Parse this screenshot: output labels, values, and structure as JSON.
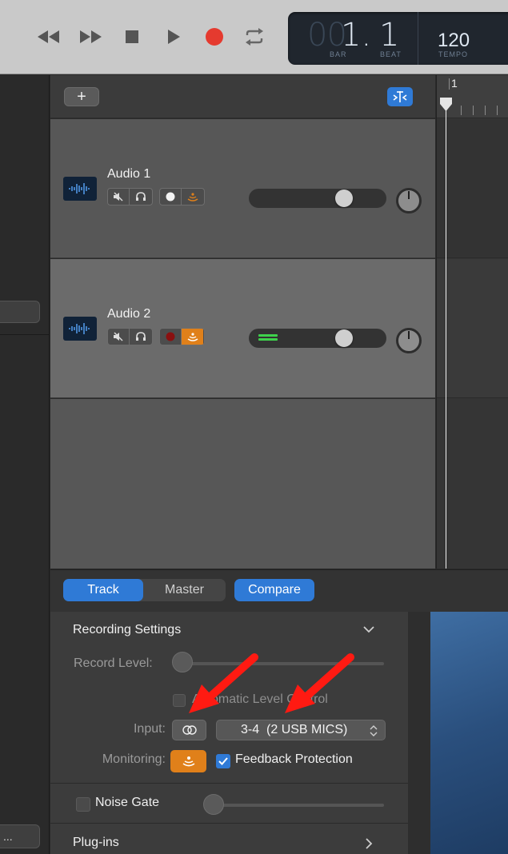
{
  "transport": {
    "controls": [
      "rewind",
      "fast-forward",
      "stop",
      "play",
      "record",
      "cycle"
    ],
    "lcd": {
      "bar_dim": "00",
      "bar_value": "1.",
      "beat_value": "1",
      "bar_caption": "BAR",
      "beat_caption": "BEAT",
      "tempo_value": "120",
      "tempo_caption": "TEMPO"
    }
  },
  "tracks_header": {
    "add_label": "+"
  },
  "tracks": [
    {
      "name": "Audio 1",
      "record_armed": false,
      "monitoring": false,
      "volume_level": 0.72,
      "meter_active": false
    },
    {
      "name": "Audio 2",
      "record_armed": true,
      "monitoring": true,
      "volume_level": 0.72,
      "meter_active": true
    }
  ],
  "timeline": {
    "ruler_number": "1"
  },
  "left_panel": {
    "bottom_button_label": "..."
  },
  "inspector": {
    "tabs": [
      "Track",
      "Master"
    ],
    "active_tab": "Track",
    "compare_label": "Compare",
    "recording_settings": {
      "title": "Recording Settings",
      "record_level_label": "Record Level:",
      "automatic_level_label": "Automatic Level Control",
      "input_label": "Input:",
      "input_value": "3-4  (2 USB MICS)",
      "monitoring_label": "Monitoring:",
      "feedback_protection_label": "Feedback Protection",
      "feedback_protection_checked": true,
      "automatic_level_checked": false
    },
    "noise_gate": {
      "label": "Noise Gate",
      "checked": false
    },
    "plugins_label": "Plug-ins"
  },
  "colors": {
    "accent_blue": "#2f7ad6",
    "record_red": "#e53a2f",
    "monitor_orange": "#e0801a",
    "meter_green": "#3ed24c",
    "annotation_red": "#ff1a12"
  }
}
